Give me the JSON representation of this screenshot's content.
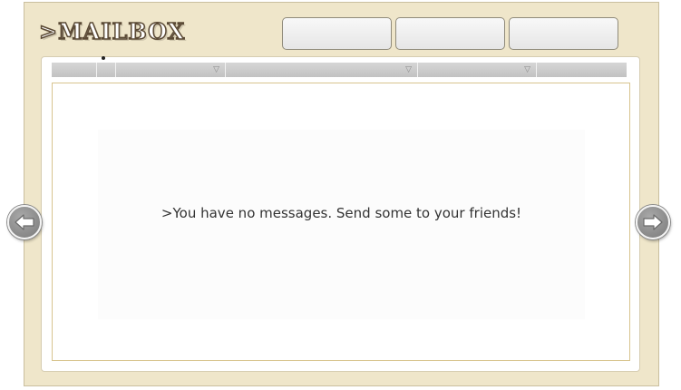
{
  "header": {
    "title": ">MAILBOX",
    "tab_buttons": [
      {
        "label": ""
      },
      {
        "label": ""
      },
      {
        "label": ""
      }
    ]
  },
  "table": {
    "columns": [
      {
        "label": "",
        "sortable": false
      },
      {
        "label": "",
        "sortable": false
      },
      {
        "label": "",
        "sortable": true
      },
      {
        "label": "",
        "sortable": true
      },
      {
        "label": "",
        "sortable": true
      },
      {
        "label": "",
        "sortable": false
      }
    ],
    "sort_icon": "▽"
  },
  "messages": {
    "empty_text": ">You have no messages. Send some to your friends!"
  },
  "navigation": {
    "prev_icon": "arrow-left-icon",
    "next_icon": "arrow-right-icon"
  },
  "colors": {
    "frame_bg": "#efe6ca",
    "title_outline": "#5b4a35",
    "list_border": "#d8c48e",
    "nav_button": "#8a8a8a"
  }
}
